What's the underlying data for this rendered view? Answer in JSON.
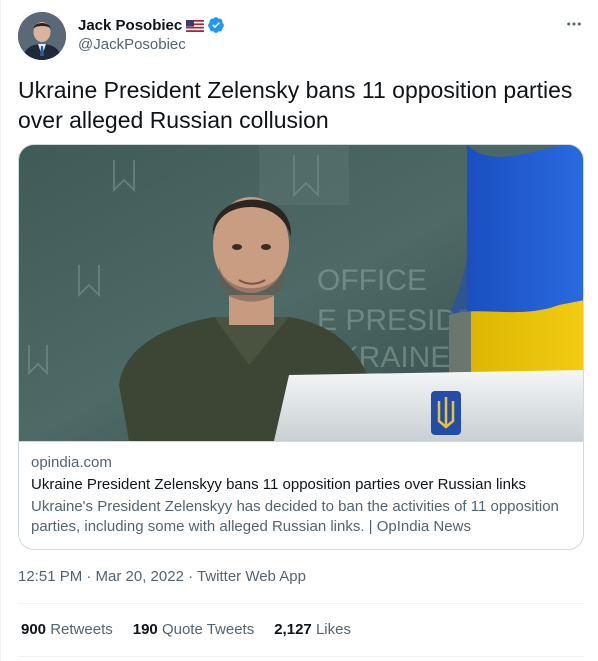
{
  "author": {
    "display_name": "Jack Posobiec",
    "handle": "@JackPosobiec",
    "avatar_icon": "user-avatar",
    "verified": true,
    "verified_color": "#1d9bf0"
  },
  "tweet": {
    "text": "Ukraine President Zelensky bans 11 opposition parties over alleged Russian collusion"
  },
  "card": {
    "image_icon": "news-photo",
    "domain": "opindia.com",
    "title": "Ukraine President Zelenskyy bans 11 opposition parties over Russian links",
    "description": "Ukraine's President Zelenskyy has decided to ban the activities of 11 opposition parties, including some with alleged Russian links. | OpIndia News"
  },
  "meta": {
    "text": "12:51 PM · Mar 20, 2022 · Twitter Web App"
  },
  "stats": {
    "retweets_count": "900",
    "retweets_label": "Retweets",
    "quotes_count": "190",
    "quotes_label": "Quote Tweets",
    "likes_count": "2,127",
    "likes_label": "Likes"
  },
  "colors": {
    "primary_text": "#0f1419",
    "secondary_text": "#536471",
    "border": "#cfd9de",
    "accent": "#1d9bf0"
  }
}
